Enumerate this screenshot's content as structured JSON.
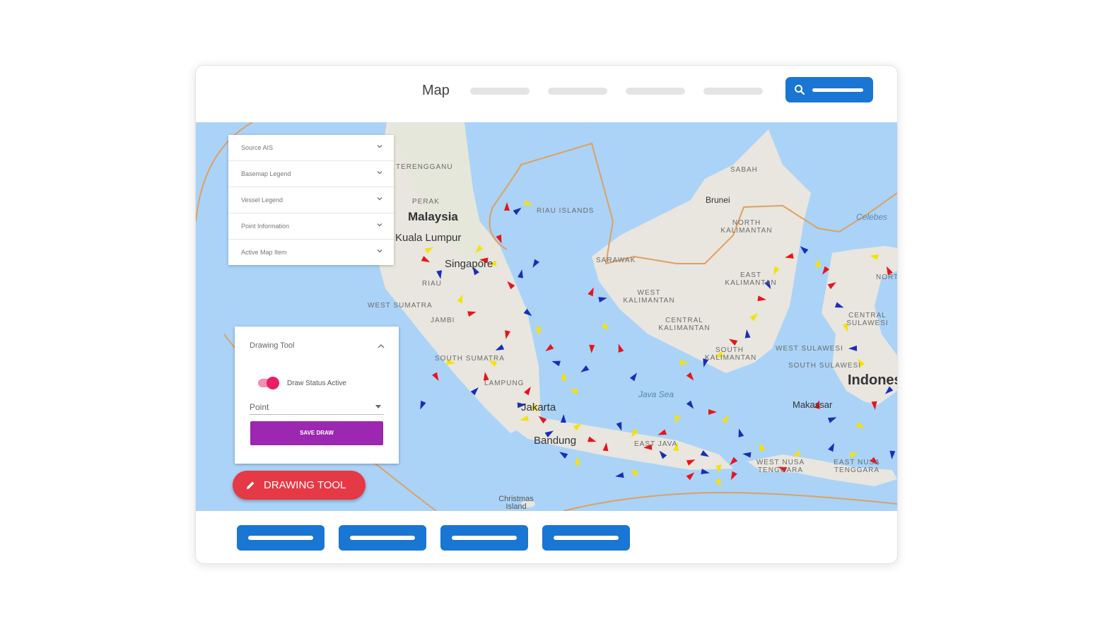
{
  "header": {
    "title": "Map",
    "nav_item_count": 4
  },
  "legend_panel": {
    "items": [
      "Source AIS",
      "Basemap Legend",
      "Vessel Legend",
      "Point Information",
      "Active Map Item"
    ]
  },
  "drawing_panel": {
    "title": "Drawing Tool",
    "toggle_label": "Draw Status Active",
    "toggle_on": true,
    "geometry_type": "Point",
    "save_label": "SAVE DRAW"
  },
  "fab": {
    "label": "DRAWING TOOL"
  },
  "map_labels": {
    "malaysia": "Malaysia",
    "kuala_lumpur": "Kuala Lumpur",
    "singapore": "Singapore",
    "brunei": "Brunei",
    "jakarta": "Jakarta",
    "bandung": "Bandung",
    "makassar": "Makassar",
    "indonesia": "Indonesia",
    "java_sea": "Java Sea",
    "christmas_island": "Christmas Island",
    "sabah": "SABAH",
    "terengganu": "TERENGGANU",
    "perak": "PERAK",
    "riau_islands": "RIAU ISLANDS",
    "sarawak": "SARAWAK",
    "north_kalimantan": "NORTH KALIMANTAN",
    "east_kalimantan": "EAST KALIMANTAN",
    "west_kalimantan": "WEST KALIMANTAN",
    "central_kalimantan": "CENTRAL KALIMANTAN",
    "south_kalimantan": "SOUTH KALIMANTAN",
    "riau": "RIAU",
    "west_sumatra": "WEST SUMATRA",
    "jambi": "JAMBI",
    "south_sumatra": "SOUTH SUMATRA",
    "lampung": "LAMPUNG",
    "east_java": "EAST JAVA",
    "west_nusa_tenggara": "WEST NUSA TENGGARA",
    "east_nusa_tenggara": "EAST NUSA TENGGARA",
    "west_sulawesi": "WEST SULAWESI",
    "south_sulawesi": "SOUTH SULAWESI",
    "central_sulawesi": "CENTRAL SULAWESI",
    "north": "NORTH",
    "celebes": "Celebes"
  },
  "vessel_colors": [
    "#e8141b",
    "#1a2db8",
    "#f5e10a"
  ],
  "colors": {
    "sea": "#aad3f7",
    "land": "#e8e6df",
    "primary": "#1976d2",
    "save": "#9c27b0",
    "fab": "#e53945",
    "toggle": "#e91e63"
  },
  "footer": {
    "button_count": 4
  }
}
